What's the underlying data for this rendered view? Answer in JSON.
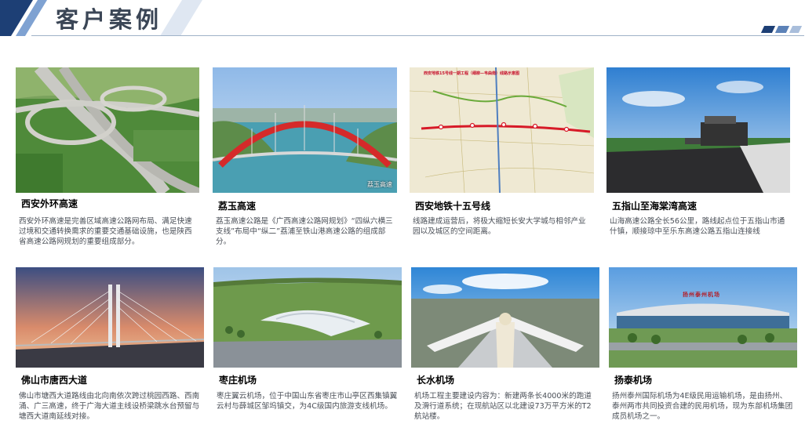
{
  "page": {
    "title": "客户案例"
  },
  "cases": [
    {
      "title": "西安外环高速",
      "image": "highway-interchange-photo",
      "text": "西安外环高速是完善区域高速公路网布局、满足快速过境和交通转换需求的重要交通基础设施，也是陕西省高速公路网规划的重要组成部分。"
    },
    {
      "title": "荔玉高速",
      "image": "red-arch-bridge-photo",
      "text": "荔玉高速公路是《广西高速公路网规划》“四纵六横三支线”布局中“纵二”荔浦至铁山港高速公路的组成部分。",
      "watermark": "荔玉高速"
    },
    {
      "title": "西安地铁十五号线",
      "image": "metro-line-map",
      "text": "线路建成运营后，将极大缩短长安大学城与相邻产业园以及城区的空间距离。",
      "map_title": "西安地铁15号线一期工程（细柳—韦曲南）线路示意图"
    },
    {
      "title": "五指山至海棠湾高速",
      "image": "asphalt-paving-photo",
      "text": "山海高速公路全长56公里，路线起点位于五指山市通什镇，顺接琼中至乐东高速公路五指山连接线"
    },
    {
      "title": "佛山市唐西大道",
      "image": "cable-stayed-bridge-photo",
      "text": "佛山市塘西大道路线由北向南依次跨过桃园西路、西南涌、广三高速，终于广海大道主线设桥梁跳水台预留与塘西大道南延线对接。"
    },
    {
      "title": "枣庄机场",
      "image": "airport-terminal-rendering",
      "text": "枣庄翼云机场，位于中国山东省枣庄市山亭区西集镇翼云村与薛城区邹坞镇交，为4C级国内旅游支线机场。"
    },
    {
      "title": "长水机场",
      "image": "airport-aerial-photo",
      "text": "机场工程主要建设内容为：新建两条长4000米的跑道及滑行道系统；在现航站区以北建设73万平方米的T2航站楼。"
    },
    {
      "title": "扬泰机场",
      "image": "airport-terminal-photo",
      "text": "扬州泰州国际机场为4E级民用运输机场，是由扬州、泰州两市共同投资合建的民用机场，现为东部机场集团成员机场之一。",
      "sign": "扬州泰州机场"
    }
  ],
  "colors": {
    "title": "#3b4656",
    "accent_dark": "#1d3f75",
    "accent_light": "#7fa2d2",
    "rule": "#9fb2c8"
  }
}
